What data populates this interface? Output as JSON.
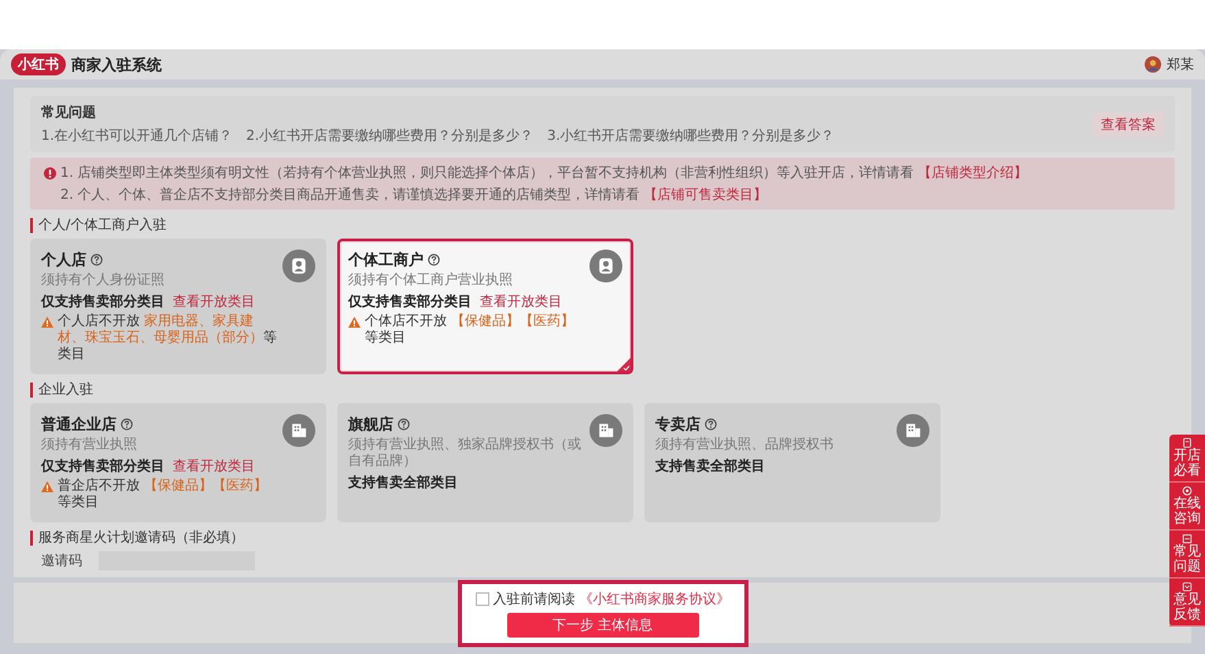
{
  "header": {
    "logo": "小红书",
    "title": "商家入驻系统",
    "user": "郑某"
  },
  "faq": {
    "title": "常见问题",
    "questions": [
      "1.在小红书可以开通几个店铺？",
      "2.小红书开店需要缴纳哪些费用？分别是多少？",
      "3.小红书开店需要缴纳哪些费用？分别是多少？"
    ],
    "button": "查看答案"
  },
  "notices": [
    {
      "text": "1. 店铺类型即主体类型须有明文性（若持有个体营业执照，则只能选择个体店），平台暂不支持机构（非营利性组织）等入驻开店，详情请看",
      "link": "【店铺类型介绍】"
    },
    {
      "text": "2. 个人、个体、普企店不支持部分类目商品开通售卖，请谨慎选择要开通的店铺类型，详情请看",
      "link": "【店铺可售卖类目】"
    }
  ],
  "sections": [
    {
      "title": "个人/个体工商户入驻",
      "stores": [
        {
          "name": "个人店",
          "description": "须持有个人身份证照",
          "category_note": "仅支持售卖部分类目",
          "link": "查看开放类目",
          "warning": {
            "prefix": "个人店不开放",
            "items": "家用电器、家具建材、珠宝玉石、母婴用品（部分）",
            "suffix": "等类目"
          },
          "selected": false
        },
        {
          "name": "个体工商户",
          "description": "须持有个体工商户营业执照",
          "category_note": "仅支持售卖部分类目",
          "link": "查看开放类目",
          "warning": {
            "prefix": "个体店不开放",
            "items": "【保健品】【医药】",
            "suffix": "等类目"
          },
          "selected": true
        }
      ]
    },
    {
      "title": "企业入驻",
      "stores": [
        {
          "name": "普通企业店",
          "description": "须持有营业执照",
          "category_note": "仅支持售卖部分类目",
          "link": "查看开放类目",
          "warning": {
            "prefix": "普企店不开放",
            "items": "【保健品】【医药】",
            "suffix": "等类目"
          },
          "selected": false
        },
        {
          "name": "旗舰店",
          "description": "须持有营业执照、独家品牌授权书（或自有品牌）",
          "category_note": "支持售卖全部类目",
          "selected": false
        },
        {
          "name": "专卖店",
          "description": "须持有营业执照、品牌授权书",
          "category_note": "支持售卖全部类目",
          "selected": false
        }
      ]
    }
  ],
  "invite": {
    "title": "服务商星火计划邀请码（非必填）",
    "label": "邀请码"
  },
  "agreement": {
    "checked": false,
    "text": "入驻前请阅读",
    "link": "《小红书商家服务协议》"
  },
  "next_button": "下一步 主体信息",
  "floating_menu": [
    {
      "label": "开店必看"
    },
    {
      "label": "在线咨询"
    },
    {
      "label": "常见问题"
    },
    {
      "label": "意见反馈"
    }
  ]
}
